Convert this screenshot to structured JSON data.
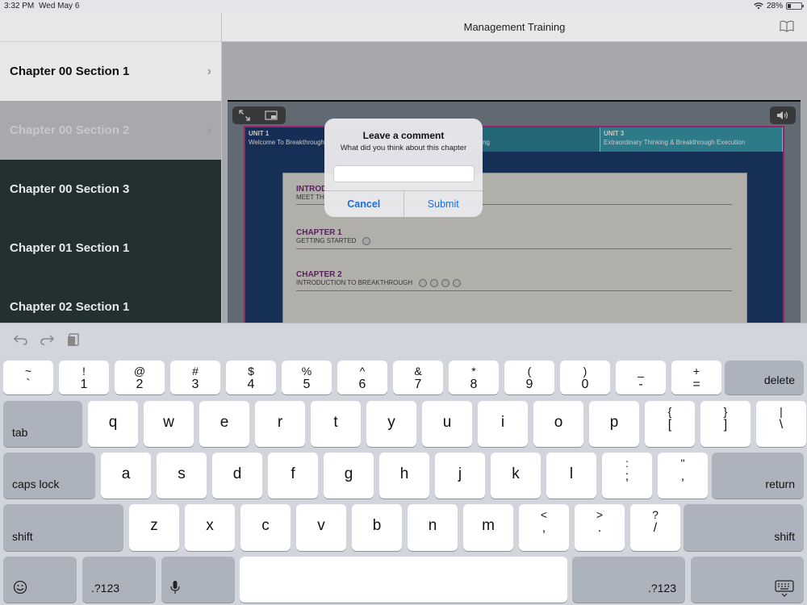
{
  "status": {
    "time": "3:32 PM",
    "date": "Wed May 6",
    "battery": "28%",
    "battery_level": 0.28
  },
  "nav": {
    "title": "Management Training"
  },
  "sidebar": {
    "items": [
      {
        "label": "Chapter 00 Section 1",
        "style": "light"
      },
      {
        "label": "Chapter 00 Section 2",
        "style": "selected"
      },
      {
        "label": "Chapter 00 Section 3",
        "style": "dark"
      },
      {
        "label": "Chapter 01 Section 1",
        "style": "dark"
      },
      {
        "label": "Chapter 02 Section 1",
        "style": "dark"
      }
    ]
  },
  "slide": {
    "units": [
      {
        "num": "UNIT 1",
        "title": "Welcome To Breakthrough"
      },
      {
        "num": "",
        "title": "Current Thinking"
      },
      {
        "num": "UNIT 3",
        "title": "Extraordinary Thinking & Breakthrough Execution"
      }
    ],
    "chapters": [
      {
        "title": "INTROD",
        "subtitle": "MEET TH"
      },
      {
        "title": "CHAPTER 1",
        "subtitle": "GETTING STARTED"
      },
      {
        "title": "CHAPTER 2",
        "subtitle": "INTRODUCTION TO BREAKTHROUGH"
      }
    ]
  },
  "alert": {
    "title": "Leave a comment",
    "message": "What did you think about this chapter",
    "input_value": "",
    "cancel": "Cancel",
    "submit": "Submit"
  },
  "keyboard": {
    "row1": [
      [
        "~",
        "`"
      ],
      [
        "!",
        "1"
      ],
      [
        "@",
        "2"
      ],
      [
        "#",
        "3"
      ],
      [
        "$",
        "4"
      ],
      [
        "%",
        "5"
      ],
      [
        "^",
        "6"
      ],
      [
        "&",
        "7"
      ],
      [
        "*",
        "8"
      ],
      [
        "(",
        "9"
      ],
      [
        ")",
        "0"
      ],
      [
        "_",
        "-"
      ],
      [
        "+",
        "="
      ]
    ],
    "delete": "delete",
    "tab": "tab",
    "row2": [
      "q",
      "w",
      "e",
      "r",
      "t",
      "y",
      "u",
      "i",
      "o",
      "p"
    ],
    "row2_sym": [
      [
        "{",
        "["
      ],
      [
        "}",
        "]"
      ],
      [
        "|",
        "\\"
      ]
    ],
    "caps": "caps lock",
    "row3": [
      "a",
      "s",
      "d",
      "f",
      "g",
      "h",
      "j",
      "k",
      "l"
    ],
    "row3_sym": [
      [
        ":",
        ";"
      ],
      [
        "\"",
        ","
      ]
    ],
    "return": "return",
    "shift": "shift",
    "row4": [
      "z",
      "x",
      "c",
      "v",
      "b",
      "n",
      "m"
    ],
    "row4_sym": [
      [
        "<",
        ","
      ],
      [
        ">",
        "."
      ],
      [
        "?",
        "/"
      ]
    ],
    "numkey": ".?123",
    "colors": {
      "letter_key": "#ffffff",
      "mod_key": "#adb3bd",
      "background": "#d2d5db",
      "link": "#1a6fd6"
    }
  }
}
